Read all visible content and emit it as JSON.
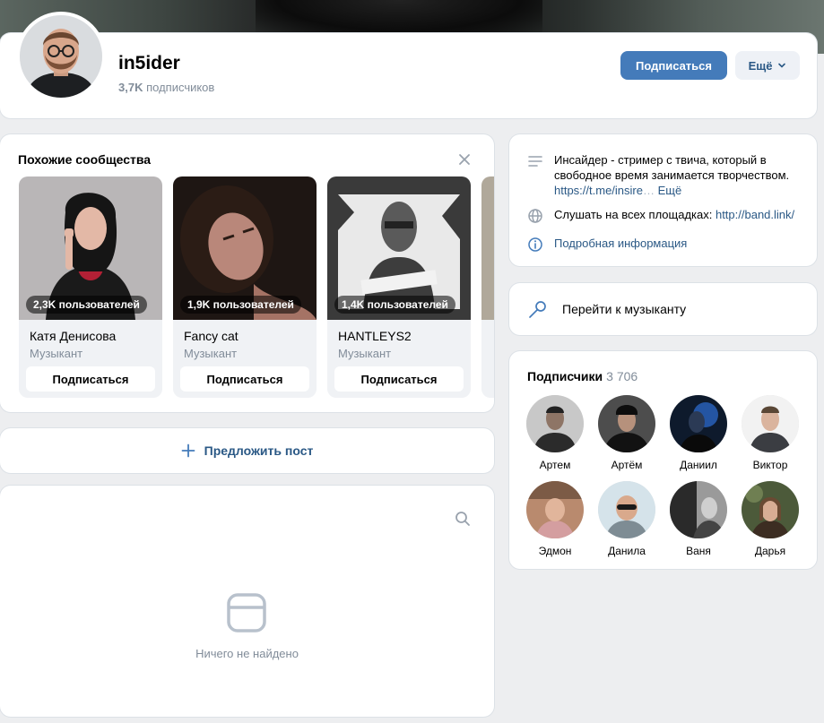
{
  "header": {
    "name": "in5ider",
    "subscribers_count": "3,7K",
    "subscribers_label": "подписчиков",
    "subscribe_button": "Подписаться",
    "more_button": "Ещё"
  },
  "similar": {
    "title": "Похожие сообщества",
    "items": [
      {
        "users": "2,3K пользователей",
        "name": "Катя Денисова",
        "category": "Музыкант",
        "button": "Подписаться"
      },
      {
        "users": "1,9K пользователей",
        "name": "Fancy cat",
        "category": "Музыкант",
        "button": "Подписаться"
      },
      {
        "users": "1,4K пользователей",
        "name": "HANTLEYS2",
        "category": "Музыкант",
        "button": "Подписаться"
      }
    ]
  },
  "suggest_post": "Предложить пост",
  "wall": {
    "empty_text": "Ничего не найдено"
  },
  "info": {
    "description_line1": "Инсайдер - стример с твича, который в",
    "description_line2": "свободное время занимается творчеством.",
    "description_link": "https://t.me/insire",
    "description_more": "Ещё",
    "listen_text": "Слушать на всех площадках: ",
    "listen_link": "http://band.link/",
    "details": "Подробная информация"
  },
  "musician_link": "Перейти к музыканту",
  "followers": {
    "title": "Подписчики",
    "count": "3 706",
    "people": [
      "Артем",
      "Артём",
      "Даниил",
      "Виктор",
      "Эдмон",
      "Данила",
      "Ваня",
      "Дарья"
    ]
  },
  "colors": {
    "accent": "#447bba",
    "link": "#2a5885",
    "secondary_text": "#818c99",
    "background": "#edeef0"
  }
}
